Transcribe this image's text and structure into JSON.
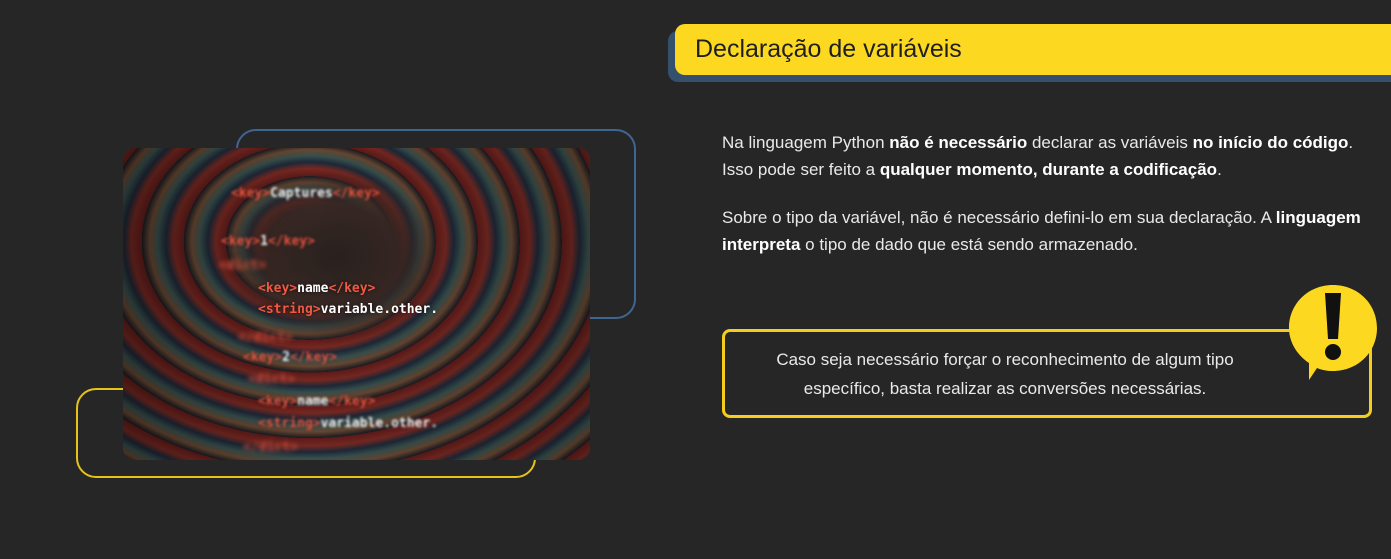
{
  "header": {
    "title": "Declaração de variáveis"
  },
  "content": {
    "paragraph1": {
      "t1": "Na linguagem Python ",
      "b1": "não é necessário",
      "t2": " declarar as variáveis ",
      "b2": "no início do código",
      "t3": ".",
      "t4": "Isso pode ser feito a ",
      "b3": "qualquer momento, durante a codificação",
      "t5": "."
    },
    "paragraph2": {
      "t1": "Sobre o tipo da variável, não é necessário defini-lo em sua declaração. A ",
      "b1": "linguagem interpreta",
      "t2": " o tipo de dado que está sendo armazenado."
    }
  },
  "callout": {
    "line1": "Caso seja necessário forçar o reconhecimento de algum tipo",
    "line2": "específico, basta realizar as conversões necessárias.",
    "icon": "exclamation-icon"
  },
  "code_image": {
    "lines": [
      {
        "tag1": "<key>",
        "val": "Captures",
        "tag2": "</key>"
      },
      {
        "tag1": "<key>",
        "val": "1",
        "tag2": "</key>"
      },
      {
        "tag1": "<dict>",
        "val": "",
        "tag2": ""
      },
      {
        "tag1": "<key>",
        "val": "name",
        "tag2": "</key>"
      },
      {
        "tag1": "<string>",
        "val": "variable.other.",
        "tag2": ""
      },
      {
        "tag1": "</dict>",
        "val": "",
        "tag2": ""
      },
      {
        "tag1": "<key>",
        "val": "2",
        "tag2": "</key>"
      },
      {
        "tag1": "<dict>",
        "val": "",
        "tag2": ""
      },
      {
        "tag1": "<key>",
        "val": "name",
        "tag2": "</key>"
      },
      {
        "tag1": "<string>",
        "val": "variable.other.",
        "tag2": ""
      },
      {
        "tag1": "</dict>",
        "val": "",
        "tag2": ""
      }
    ]
  },
  "colors": {
    "background": "#262626",
    "accent_yellow": "#fcd920",
    "accent_blue": "#3f6690",
    "text": "#e9e9e9"
  }
}
